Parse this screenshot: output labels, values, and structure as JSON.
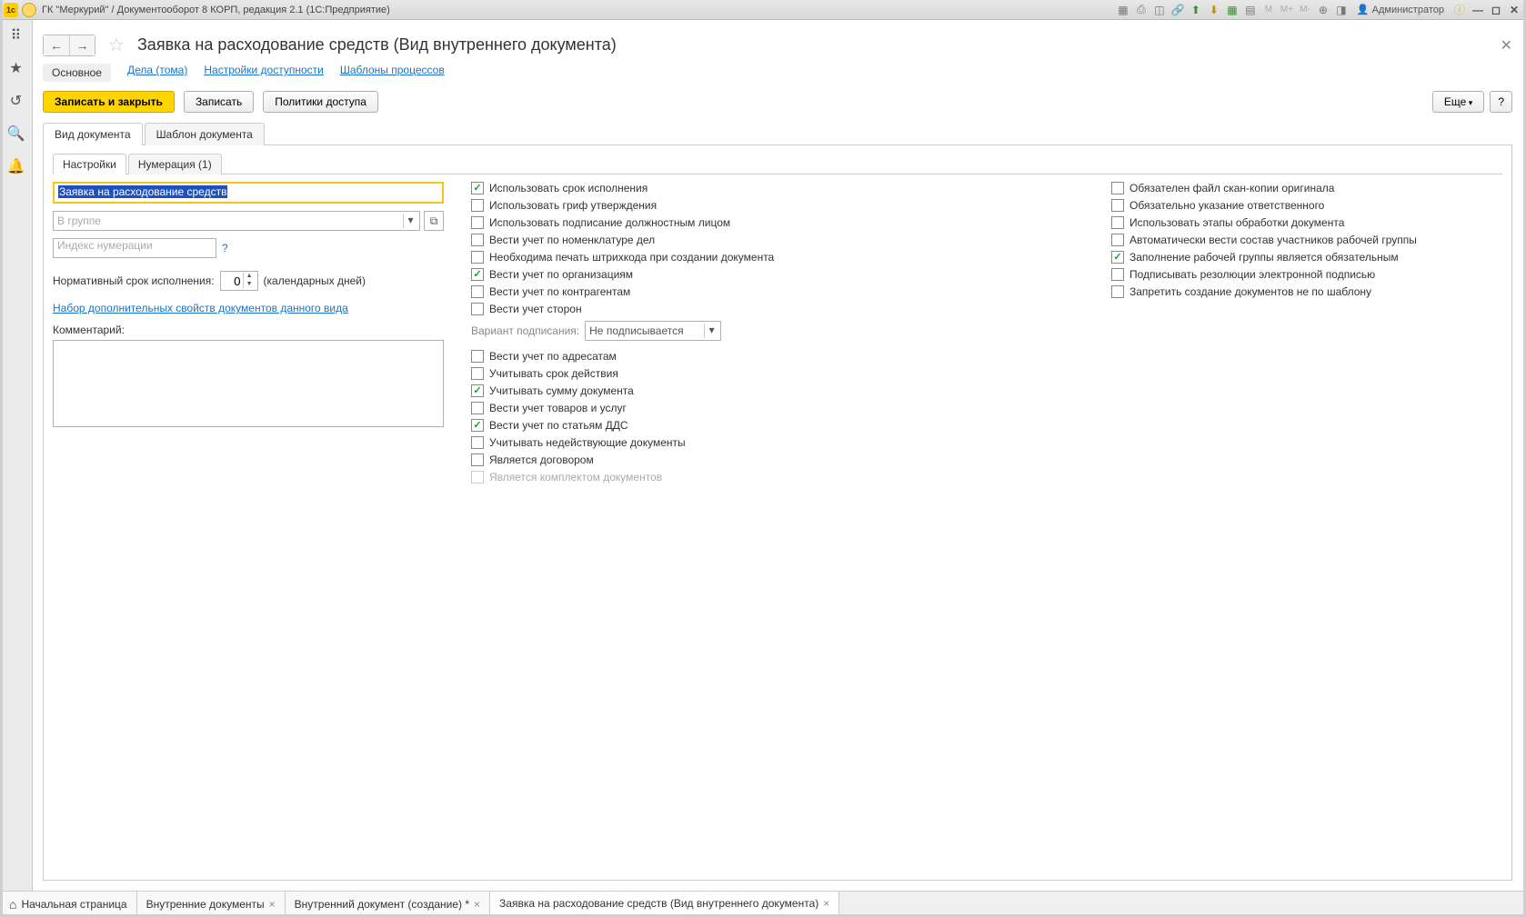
{
  "titlebar": {
    "title": "ГК \"Меркурий\" / Документооборот 8 КОРП, редакция 2.1  (1С:Предприятие)",
    "user": "Администратор",
    "m_labels": [
      "M",
      "M+",
      "M-"
    ]
  },
  "page": {
    "title": "Заявка на расходование средств (Вид внутреннего документа)",
    "link_tabs": [
      "Основное",
      "Дела (тома)",
      "Настройки доступности",
      "Шаблоны процессов"
    ],
    "buttons": {
      "save_close": "Записать и закрыть",
      "save": "Записать",
      "policies": "Политики доступа",
      "more": "Еще",
      "help": "?"
    },
    "tabs": [
      "Вид документа",
      "Шаблон документа"
    ],
    "sub_tabs": [
      "Настройки",
      "Нумерация (1)"
    ]
  },
  "form": {
    "name_value": "Заявка на расходование средств",
    "group_placeholder": "В группе",
    "index_placeholder": "Индекс нумерации",
    "term_label": "Нормативный срок исполнения:",
    "term_value": "0",
    "term_suffix": "(календарных дней)",
    "props_link": "Набор дополнительных свойств документов данного вида",
    "comment_label": "Комментарий:"
  },
  "checks_mid": [
    {
      "label": "Использовать срок исполнения",
      "checked": true
    },
    {
      "label": "Использовать гриф утверждения",
      "checked": false
    },
    {
      "label": "Использовать подписание должностным лицом",
      "checked": false
    },
    {
      "label": "Вести учет по номенклатуре дел",
      "checked": false
    },
    {
      "label": "Необходима печать штрихкода при создании документа",
      "checked": false
    },
    {
      "label": "Вести учет по организациям",
      "checked": true
    },
    {
      "label": "Вести учет по контрагентам",
      "checked": false
    },
    {
      "label": "Вести учет сторон",
      "checked": false
    }
  ],
  "sign": {
    "label": "Вариант подписания:",
    "value": "Не подписывается"
  },
  "checks_mid2": [
    {
      "label": "Вести учет по адресатам",
      "checked": false
    },
    {
      "label": "Учитывать срок действия",
      "checked": false
    },
    {
      "label": "Учитывать сумму документа",
      "checked": true
    },
    {
      "label": "Вести учет товаров и услуг",
      "checked": false
    },
    {
      "label": "Вести учет по статьям ДДС",
      "checked": true
    },
    {
      "label": "Учитывать недействующие документы",
      "checked": false
    },
    {
      "label": "Является договором",
      "checked": false
    },
    {
      "label": "Является комплектом документов",
      "checked": false,
      "disabled": true
    }
  ],
  "checks_right": [
    {
      "label": "Обязателен файл скан-копии оригинала",
      "checked": false
    },
    {
      "label": "Обязательно указание ответственного",
      "checked": false
    },
    {
      "label": "Использовать этапы обработки документа",
      "checked": false
    },
    {
      "label": "Автоматически вести состав участников рабочей группы",
      "checked": false
    },
    {
      "label": "Заполнение рабочей группы является обязательным",
      "checked": true
    },
    {
      "label": "Подписывать резолюции электронной подписью",
      "checked": false
    },
    {
      "label": "Запретить создание документов не по шаблону",
      "checked": false
    }
  ],
  "taskbar": [
    {
      "label": "Начальная страница",
      "home": true
    },
    {
      "label": "Внутренние документы",
      "close": true
    },
    {
      "label": "Внутренний документ (создание) *",
      "close": true
    },
    {
      "label": "Заявка на расходование средств (Вид внутреннего документа)",
      "close": true,
      "active": true
    }
  ]
}
